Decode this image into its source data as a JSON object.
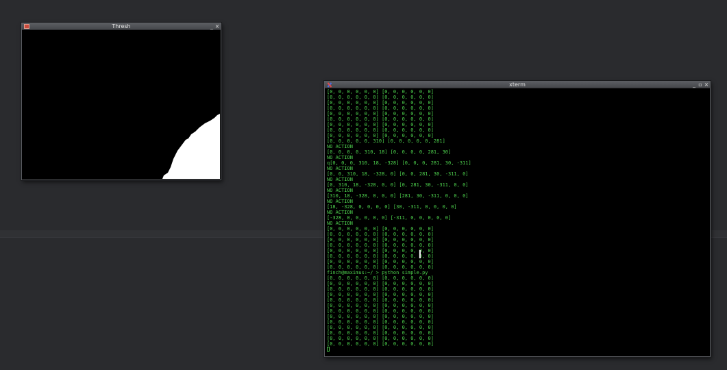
{
  "thresh_window": {
    "title": "Thresh",
    "minimize_glyph": "_",
    "close_glyph": "×"
  },
  "xterm_window": {
    "title": "xterm",
    "minimize_glyph": "_",
    "maximize_glyph": "▫",
    "close_glyph": "×"
  },
  "terminal_lines": [
    "[0, 0, 0, 0, 0, 0] [0, 0, 0, 0, 0, 0]",
    "[0, 0, 0, 0, 0, 0] [0, 0, 0, 0, 0, 0]",
    "[0, 0, 0, 0, 0, 0] [0, 0, 0, 0, 0, 0]",
    "[0, 0, 0, 0, 0, 0] [0, 0, 0, 0, 0, 0]",
    "[0, 0, 0, 0, 0, 0] [0, 0, 0, 0, 0, 0]",
    "[0, 0, 0, 0, 0, 0] [0, 0, 0, 0, 0, 0]",
    "[0, 0, 0, 0, 0, 0] [0, 0, 0, 0, 0, 0]",
    "[0, 0, 0, 0, 0, 0] [0, 0, 0, 0, 0, 0]",
    "[0, 0, 0, 0, 0, 0] [0, 0, 0, 0, 0, 0]",
    "[0, 0, 0, 0, 0, 310] [0, 0, 0, 0, 0, 281]",
    "NO ACTION",
    "[0, 0, 0, 0, 310, 18] [0, 0, 0, 0, 281, 30]",
    "NO ACTION",
    "q[0, 0, 0, 310, 18, -328] [0, 0, 0, 281, 30, -311]",
    "NO ACTION",
    "[0, 0, 310, 18, -328, 0] [0, 0, 281, 30, -311, 0]",
    "NO ACTION",
    "[0, 310, 18, -328, 0, 0] [0, 281, 30, -311, 0, 0]",
    "NO ACTION",
    "[310, 18, -328, 0, 0, 0] [281, 30, -311, 0, 0, 0]",
    "NO ACTION",
    "[18, -328, 0, 0, 0, 0] [30, -311, 0, 0, 0, 0]",
    "NO ACTION",
    "[-328, 0, 0, 0, 0, 0] [-311, 0, 0, 0, 0, 0]",
    "NO ACTION",
    "[0, 0, 0, 0, 0, 0] [0, 0, 0, 0, 0, 0]",
    "[0, 0, 0, 0, 0, 0] [0, 0, 0, 0, 0, 0]",
    "[0, 0, 0, 0, 0, 0] [0, 0, 0, 0, 0, 0]",
    "[0, 0, 0, 0, 0, 0] [0, 0, 0, 0, 0, 0]",
    "[0, 0, 0, 0, 0, 0] [0, 0, 0, 0, 0, 0]",
    "[0, 0, 0, 0, 0, 0] [0, 0, 0, 0, 0, 0]",
    "[0, 0, 0, 0, 0, 0] [0, 0, 0, 0, 0, 0]",
    "[0, 0, 0, 0, 0, 0] [0, 0, 0, 0, 0, 0]",
    "finch@maximus:~/ > python simple.py",
    "[0, 0, 0, 0, 0, 0] [0, 0, 0, 0, 0, 0]",
    "[0, 0, 0, 0, 0, 0] [0, 0, 0, 0, 0, 0]",
    "[0, 0, 0, 0, 0, 0] [0, 0, 0, 0, 0, 0]",
    "[0, 0, 0, 0, 0, 0] [0, 0, 0, 0, 0, 0]",
    "[0, 0, 0, 0, 0, 0] [0, 0, 0, 0, 0, 0]",
    "[0, 0, 0, 0, 0, 0] [0, 0, 0, 0, 0, 0]",
    "[0, 0, 0, 0, 0, 0] [0, 0, 0, 0, 0, 0]",
    "[0, 0, 0, 0, 0, 0] [0, 0, 0, 0, 0, 0]",
    "[0, 0, 0, 0, 0, 0] [0, 0, 0, 0, 0, 0]",
    "[0, 0, 0, 0, 0, 0] [0, 0, 0, 0, 0, 0]",
    "[0, 0, 0, 0, 0, 0] [0, 0, 0, 0, 0, 0]",
    "[0, 0, 0, 0, 0, 0] [0, 0, 0, 0, 0, 0]",
    "[0, 0, 0, 0, 0, 0] [0, 0, 0, 0, 0, 0]"
  ],
  "colors": {
    "desktop": "#2a2b2e",
    "terminal_text": "#4ed24e",
    "terminal_bg": "#000000",
    "mask_white": "#ffffff"
  }
}
